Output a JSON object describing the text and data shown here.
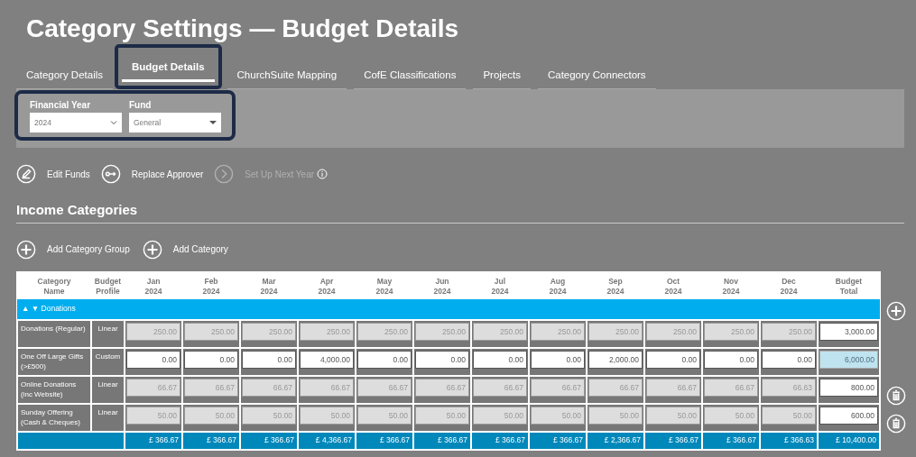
{
  "page": {
    "title": "Category Settings — Budget Details"
  },
  "tabs": [
    {
      "label": "Category Details",
      "selected": false,
      "highlighted": false
    },
    {
      "label": "Budget Details",
      "selected": true,
      "highlighted": true
    },
    {
      "label": "ChurchSuite Mapping",
      "selected": false,
      "highlighted": false
    },
    {
      "label": "CofE Classifications",
      "selected": false,
      "highlighted": false
    },
    {
      "label": "Projects",
      "selected": false,
      "highlighted": false
    },
    {
      "label": "Category Connectors",
      "selected": false,
      "highlighted": false
    }
  ],
  "filters": {
    "highlighted": true,
    "fields": [
      {
        "label": "Financial Year",
        "value": "2024",
        "kind": "chevron"
      },
      {
        "label": "Fund",
        "value": "General",
        "kind": "caret"
      }
    ]
  },
  "actions": [
    {
      "label": "Edit Funds",
      "kind": "edit",
      "disabled": false
    },
    {
      "label": "Replace Approver",
      "kind": "key",
      "disabled": false
    },
    {
      "label": "Set Up Next Year",
      "kind": "next",
      "disabled": true,
      "info": true
    }
  ],
  "section": {
    "title": "Income Categories",
    "add_buttons": [
      "Add Category Group",
      "Add Category"
    ]
  },
  "table": {
    "columns": [
      {
        "label": "Category",
        "sub": "Name"
      },
      {
        "label": "Budget",
        "sub": "Profile"
      },
      {
        "label": "Jan",
        "sub": "2024"
      },
      {
        "label": "Feb",
        "sub": "2024"
      },
      {
        "label": "Mar",
        "sub": "2024"
      },
      {
        "label": "Apr",
        "sub": "2024"
      },
      {
        "label": "May",
        "sub": "2024"
      },
      {
        "label": "Jun",
        "sub": "2024"
      },
      {
        "label": "Jul",
        "sub": "2024"
      },
      {
        "label": "Aug",
        "sub": "2024"
      },
      {
        "label": "Sep",
        "sub": "2024"
      },
      {
        "label": "Oct",
        "sub": "2024"
      },
      {
        "label": "Nov",
        "sub": "2024"
      },
      {
        "label": "Dec",
        "sub": "2024"
      },
      {
        "label": "Budget",
        "sub": "Total"
      }
    ],
    "group": {
      "toggle": "▲ ▼",
      "label": "Donations"
    },
    "rows": [
      {
        "name": "Donations (Regular)",
        "profile": "Linear",
        "months_locked": true,
        "total_locked": false,
        "deletable": false,
        "months": [
          "250.00",
          "250.00",
          "250.00",
          "250.00",
          "250.00",
          "250.00",
          "250.00",
          "250.00",
          "250.00",
          "250.00",
          "250.00",
          "250.00"
        ],
        "total": "3,000.00"
      },
      {
        "name": "One Off Large Gifts (>£500)",
        "profile": "Custom",
        "months_locked": false,
        "total_locked": true,
        "deletable": false,
        "months": [
          "0.00",
          "0.00",
          "0.00",
          "4,000.00",
          "0.00",
          "0.00",
          "0.00",
          "0.00",
          "2,000.00",
          "0.00",
          "0.00",
          "0.00"
        ],
        "total": "6,000.00"
      },
      {
        "name": "Online Donations (inc Website)",
        "profile": "Linear",
        "months_locked": true,
        "total_locked": false,
        "deletable": true,
        "months": [
          "66.67",
          "66.67",
          "66.67",
          "66.67",
          "66.67",
          "66.67",
          "66.67",
          "66.67",
          "66.67",
          "66.67",
          "66.67",
          "66.63"
        ],
        "total": "800.00"
      },
      {
        "name": "Sunday Offering (Cash & Cheques)",
        "profile": "Linear",
        "months_locked": true,
        "total_locked": false,
        "deletable": true,
        "months": [
          "50.00",
          "50.00",
          "50.00",
          "50.00",
          "50.00",
          "50.00",
          "50.00",
          "50.00",
          "50.00",
          "50.00",
          "50.00",
          "50.00"
        ],
        "total": "600.00"
      }
    ],
    "totals": [
      "£ 366.67",
      "£ 366.67",
      "£ 366.67",
      "£ 4,366.67",
      "£ 366.67",
      "£ 366.67",
      "£ 366.67",
      "£ 366.67",
      "£ 2,366.67",
      "£ 366.67",
      "£ 366.67",
      "£ 366.63",
      "£ 10,400.00"
    ]
  }
}
